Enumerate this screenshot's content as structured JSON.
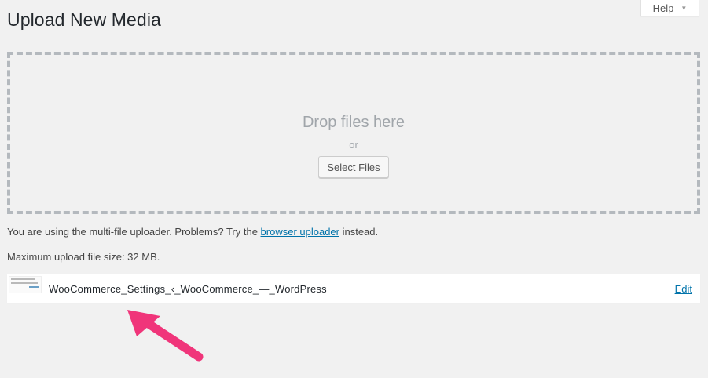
{
  "page": {
    "title": "Upload New Media"
  },
  "help": {
    "label": "Help",
    "caret_icon": "caret-down-icon"
  },
  "drop_zone": {
    "title": "Drop files here",
    "or": "or",
    "select_button": "Select Files"
  },
  "uploader_note": {
    "prefix": "You are using the multi-file uploader. Problems? Try the ",
    "link": "browser uploader",
    "suffix": " instead."
  },
  "max_size": "Maximum upload file size: 32 MB.",
  "media_item": {
    "filename": "WooCommerce_Settings_‹_WooCommerce_—_WordPress",
    "edit_label": "Edit"
  },
  "annotation": {
    "arrow_color": "#f0357a"
  },
  "colors": {
    "background": "#f1f1f1",
    "link": "#0073aa",
    "dashed_border": "#b4b9be"
  }
}
